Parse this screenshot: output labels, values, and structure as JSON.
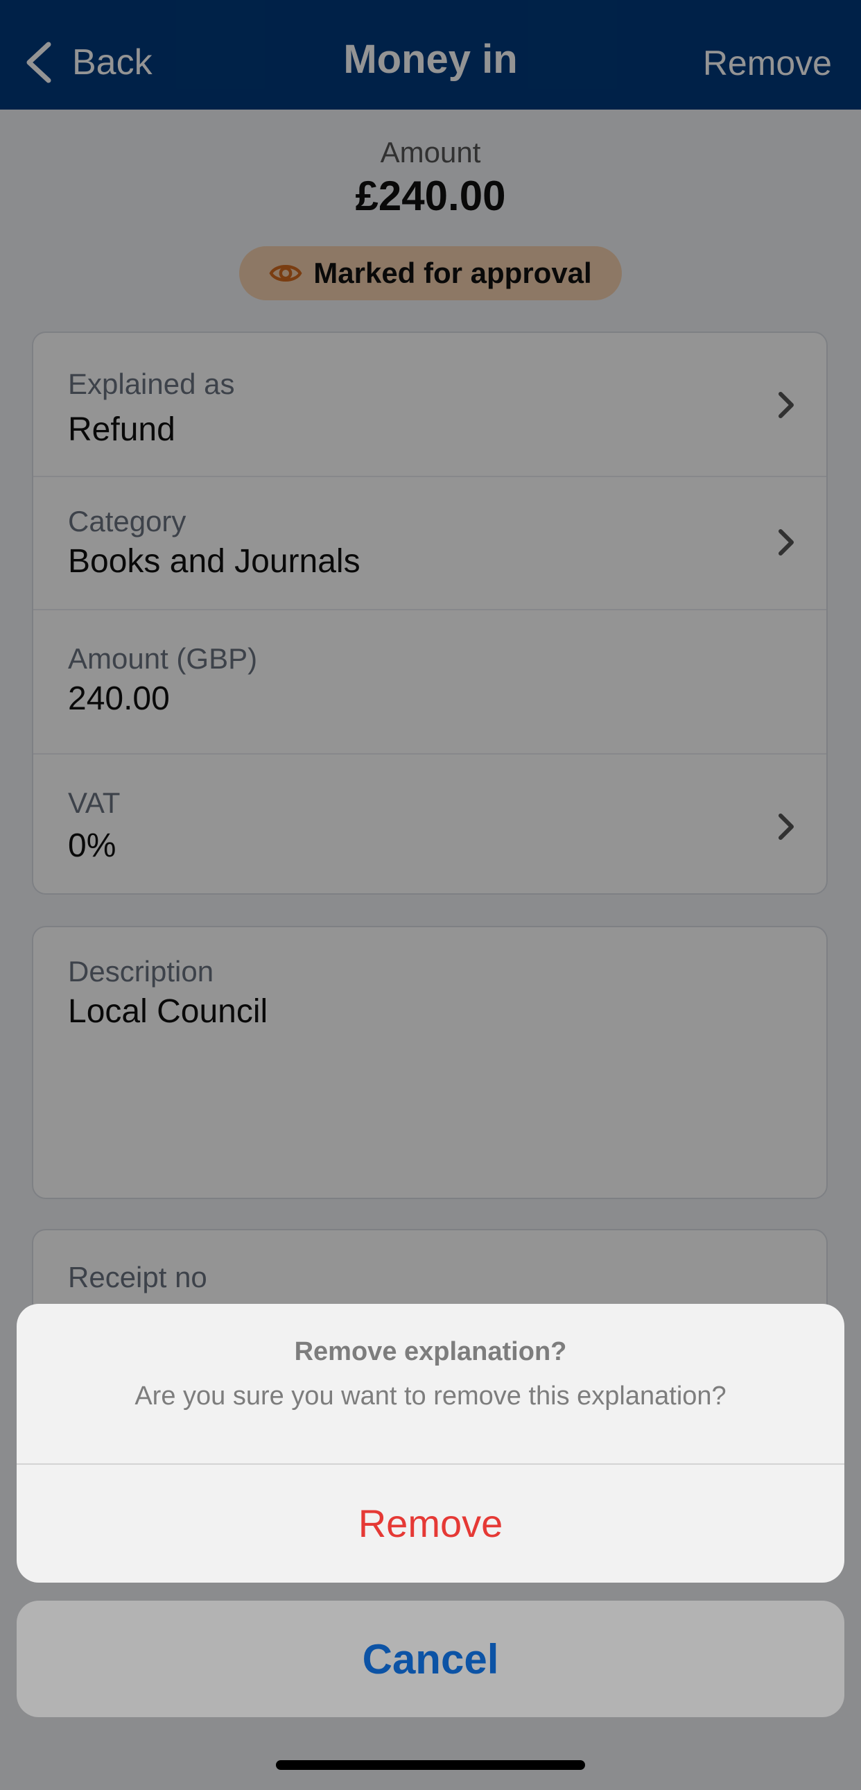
{
  "nav": {
    "back_label": "Back",
    "title": "Money in",
    "remove_label": "Remove"
  },
  "summary": {
    "amount_label": "Amount",
    "amount_value": "£240.00",
    "status_badge": "Marked for approval"
  },
  "details": [
    {
      "label": "Explained as",
      "value": "Refund"
    },
    {
      "label": "Category",
      "value": "Books and Journals"
    },
    {
      "label": "Amount (GBP)",
      "value": "240.00"
    },
    {
      "label": "VAT",
      "value": "0%"
    }
  ],
  "description": {
    "label": "Description",
    "value": "Local Council"
  },
  "receipt": {
    "label": "Receipt no"
  },
  "action_sheet": {
    "title": "Remove explanation?",
    "message": "Are you sure you want to remove this explanation?",
    "remove_label": "Remove",
    "cancel_label": "Cancel"
  },
  "colors": {
    "nav_bg": "#003a7c",
    "badge_bg": "#f3cfaf",
    "destructive": "#e53935",
    "link": "#0c53a5"
  }
}
